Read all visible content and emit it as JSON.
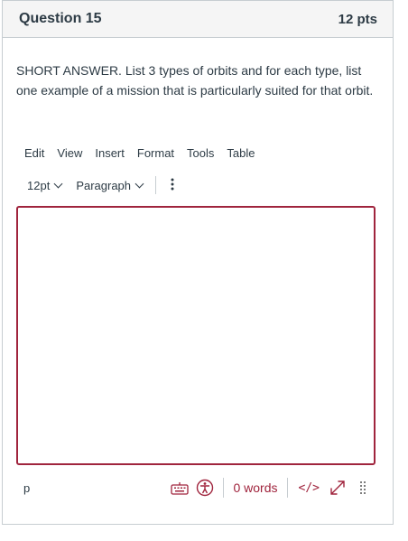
{
  "question": {
    "title": "Question 15",
    "points": "12 pts",
    "text": "SHORT ANSWER. List 3 types of orbits and for each type, list one example of a mission that is particularly suited for that orbit."
  },
  "editor": {
    "menu": [
      "Edit",
      "View",
      "Insert",
      "Format",
      "Tools",
      "Table"
    ],
    "font_size": "12pt",
    "block_format": "Paragraph",
    "content": "",
    "path": "p",
    "word_count": "0 words",
    "html_toggle": "</>",
    "icons": [
      "keyboard-icon",
      "accessibility-icon",
      "code-icon",
      "fullscreen-icon",
      "resize-grip-icon",
      "more-options-icon"
    ]
  },
  "colors": {
    "accent": "#a0243d",
    "text": "#2d3b45",
    "header_bg": "#f5f5f5",
    "border": "#c7cdd1"
  }
}
